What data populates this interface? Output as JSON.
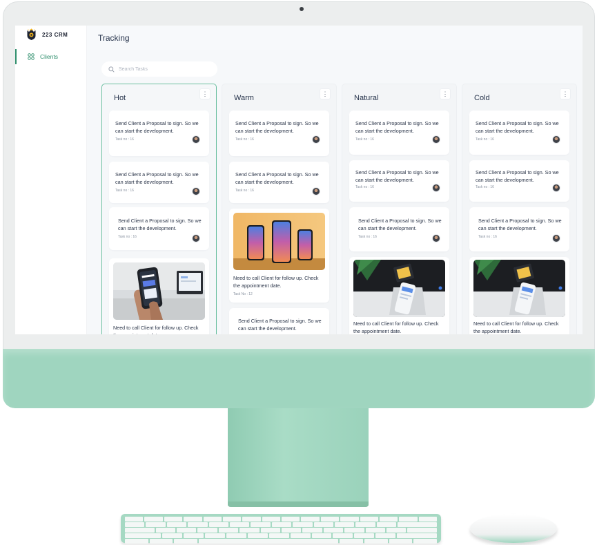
{
  "app": {
    "brand": "223 CRM",
    "page_title": "Tracking",
    "accent_color": "#2f8f6d"
  },
  "sidebar": {
    "items": [
      {
        "label": "Clients",
        "icon": "grid-icon",
        "active": true
      }
    ]
  },
  "search": {
    "placeholder": "Search Tasks"
  },
  "columns": [
    {
      "title": "Hot",
      "cards": [
        {
          "type": "task",
          "text": "Send Client a Proposal to sign. So we can start the development.",
          "meta": "Task no : 16"
        },
        {
          "type": "task",
          "text": "Send Client a Proposal to sign. So we can start the development.",
          "meta": "Task no : 16"
        },
        {
          "type": "task",
          "text": "Send Client a Proposal to sign. So we can start the development.",
          "meta": "Task no : 16"
        },
        {
          "type": "image",
          "text": "Need to call Client for follow up. Check the appointment date.",
          "image": "hand-holding-phone-image"
        }
      ]
    },
    {
      "title": "Warm",
      "cards": [
        {
          "type": "task",
          "text": "Send Client a Proposal to sign. So we can start the development.",
          "meta": "Task no : 16"
        },
        {
          "type": "task",
          "text": "Send Client a Proposal to sign. So we can start the development.",
          "meta": "Task no : 16"
        },
        {
          "type": "image",
          "text": "Need to call Client for follow up. Check the appointment date.",
          "meta": "Task No : 12",
          "image": "three-phones-image"
        },
        {
          "type": "task",
          "text": "Send Client a Proposal to sign. So we can start the development."
        }
      ]
    },
    {
      "title": "Natural",
      "cards": [
        {
          "type": "task",
          "text": "Send Client a Proposal to sign. So we can start the development.",
          "meta": "Task no : 16"
        },
        {
          "type": "task",
          "text": "Send Client a Proposal to sign. So we can start the development.",
          "meta": "Task no : 16"
        },
        {
          "type": "task",
          "text": "Send Client a Proposal to sign. So we can start the development.",
          "meta": "Task no : 16"
        },
        {
          "type": "image",
          "text": "Need to call Client for follow up. Check the appointment date.",
          "image": "desk-phones-image"
        }
      ]
    },
    {
      "title": "Cold",
      "cards": [
        {
          "type": "task",
          "text": "Send Client a Proposal to sign. So we can start the development.",
          "meta": "Task no : 16"
        },
        {
          "type": "task",
          "text": "Send Client a Proposal to sign. So we can start the development.",
          "meta": "Task no : 16"
        },
        {
          "type": "task",
          "text": "Send Client a Proposal to sign. So we can start the development.",
          "meta": "Task no : 16"
        },
        {
          "type": "image",
          "text": "Need to call Client for follow up. Check the appointment date.",
          "image": "desk-phones-image"
        }
      ]
    }
  ],
  "icons": {
    "brand_logo": "shield-badge-icon",
    "search": "search-icon",
    "column_menu": "more-vertical-icon",
    "column_menu_glyph": "⋮",
    "avatar": "user-avatar",
    "keyboard": "keyboard",
    "mouse": "mouse",
    "mouse_glyph": ""
  },
  "colors": {
    "chassis": "#9fd5bf",
    "active_column_border": "#6bbfa0",
    "board_background": "#f6f8fa"
  }
}
